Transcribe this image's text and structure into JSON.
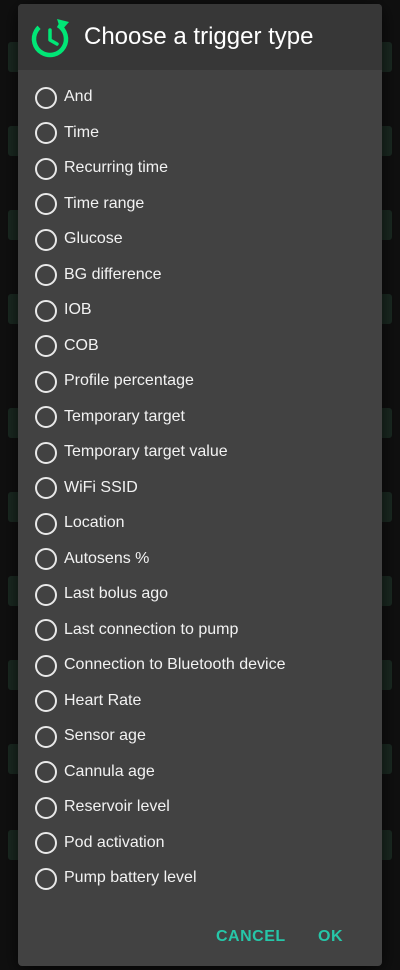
{
  "dialog": {
    "title": "Choose a trigger type",
    "icon": "clock-refresh-icon",
    "accent_color": "#00e676",
    "button_color": "#26c6a8",
    "options": [
      {
        "label": "And",
        "selected": false
      },
      {
        "label": "Time",
        "selected": false
      },
      {
        "label": "Recurring time",
        "selected": false
      },
      {
        "label": "Time range",
        "selected": false
      },
      {
        "label": "Glucose",
        "selected": false
      },
      {
        "label": "BG difference",
        "selected": false
      },
      {
        "label": "IOB",
        "selected": false
      },
      {
        "label": "COB",
        "selected": false
      },
      {
        "label": "Profile percentage",
        "selected": false
      },
      {
        "label": "Temporary target",
        "selected": false
      },
      {
        "label": "Temporary target value",
        "selected": false
      },
      {
        "label": "WiFi SSID",
        "selected": false
      },
      {
        "label": "Location",
        "selected": false
      },
      {
        "label": "Autosens %",
        "selected": false
      },
      {
        "label": "Last bolus ago",
        "selected": false
      },
      {
        "label": "Last connection to pump",
        "selected": false
      },
      {
        "label": "Connection to Bluetooth device",
        "selected": false
      },
      {
        "label": "Heart Rate",
        "selected": false
      },
      {
        "label": "Sensor age",
        "selected": false
      },
      {
        "label": "Cannula age",
        "selected": false
      },
      {
        "label": "Reservoir level",
        "selected": false
      },
      {
        "label": "Pod activation",
        "selected": false
      },
      {
        "label": "Pump battery level",
        "selected": false
      }
    ],
    "cancel_label": "CANCEL",
    "ok_label": "OK"
  }
}
